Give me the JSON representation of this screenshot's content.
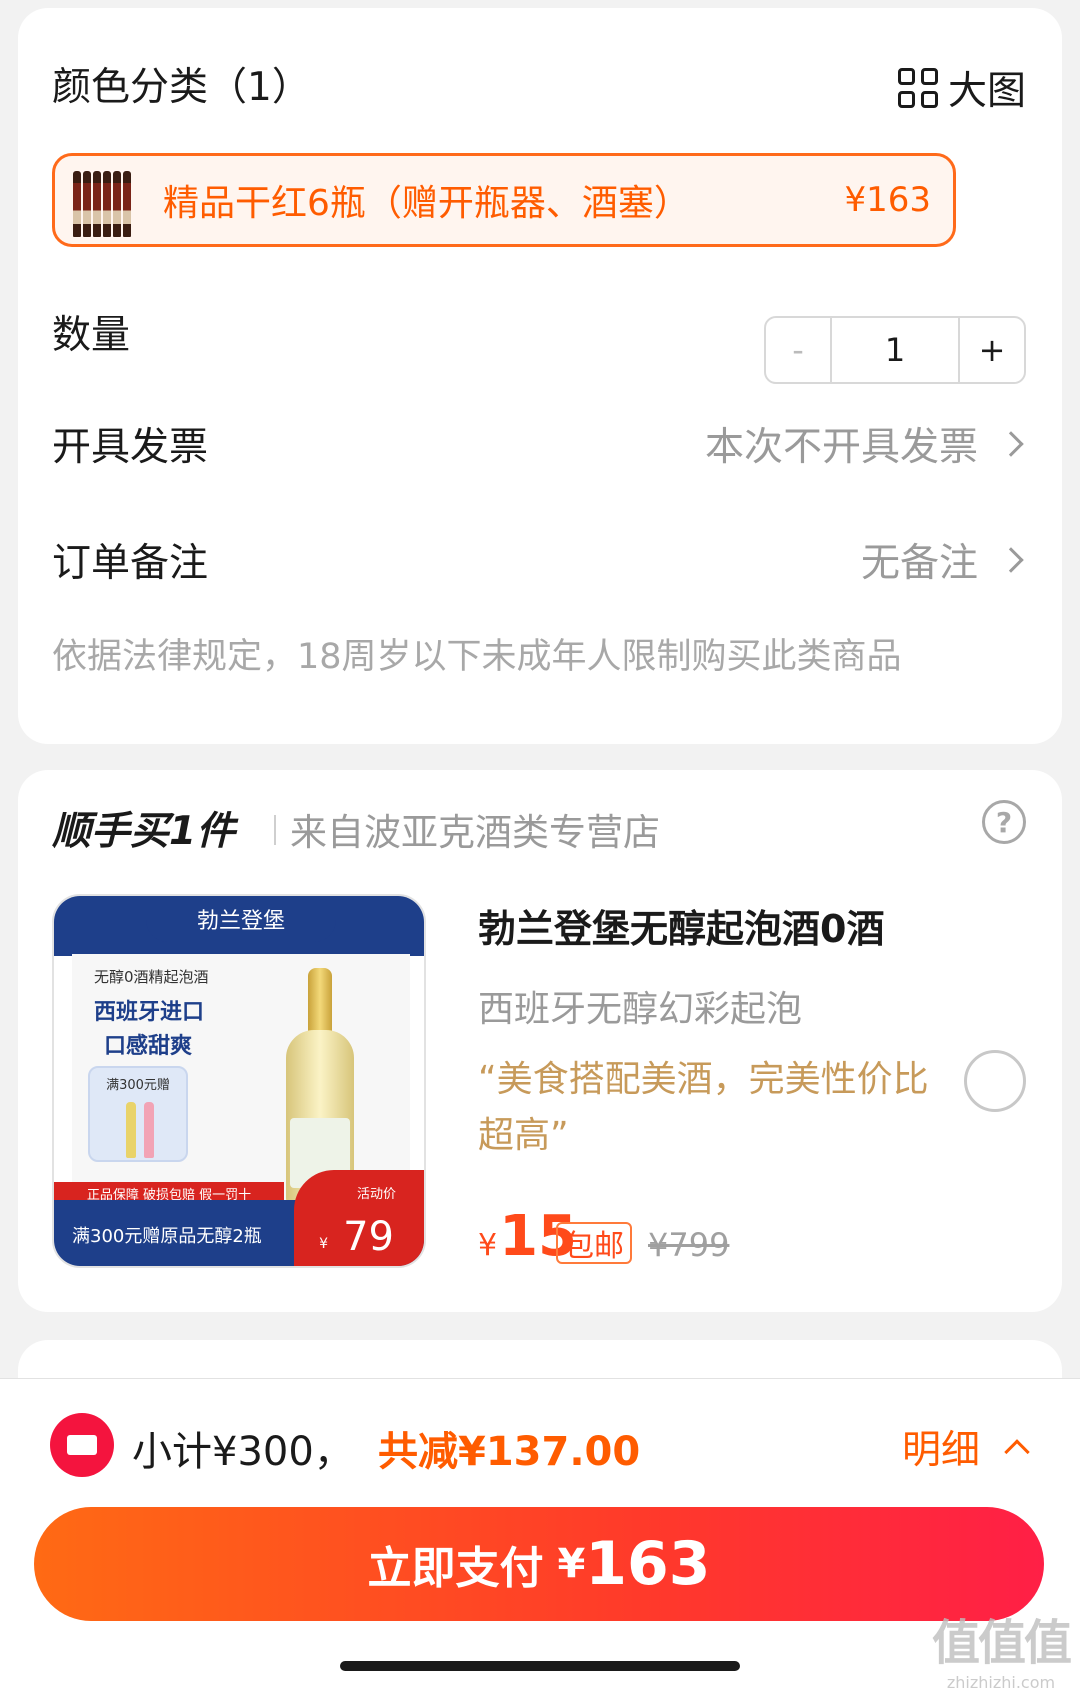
{
  "sku": {
    "header": "颜色分类（1）",
    "big_image_label": "大图",
    "option": {
      "name": "精品干红6瓶（赠开瓶器、酒塞）",
      "price": "¥163"
    }
  },
  "quantity": {
    "label": "数量",
    "minus": "-",
    "value": "1",
    "plus": "+"
  },
  "invoice": {
    "label": "开具发票",
    "value": "本次不开具发票"
  },
  "remark": {
    "label": "订单备注",
    "value": "无备注"
  },
  "legal_note": "依据法律规定，18周岁以下未成年人限制购买此类商品",
  "addon": {
    "title": "顺手买1件",
    "store": "来自波亚克酒类专营店",
    "help": "?",
    "image": {
      "brand": "勃兰登堡",
      "line1": "无醇0酒精起泡酒",
      "line2": "西班牙进口",
      "line3": "口感甜爽",
      "gift": "满300元赠",
      "guarantee": "正品保障 破损包赔 假一罚十",
      "promo": "满300元赠原品无醇2瓶",
      "price_label": "活动价",
      "price_yen": "¥",
      "price": "79"
    },
    "product": {
      "title": "勃兰登堡无醇起泡酒0酒",
      "subtitle": "西班牙无醇幻彩起泡",
      "quote": "“美食搭配美酒，完美性价比超高”",
      "price_symbol": "¥",
      "price": "15",
      "shipping_badge": "包邮",
      "original_price": "¥799"
    }
  },
  "footer": {
    "subtotal": "小计¥300，",
    "discount": "共减¥137.00",
    "detail": "明细",
    "pay_label": "立即支付",
    "pay_symbol": "¥",
    "pay_amount": "163",
    "watermark": "值值值",
    "watermark_site": "zhizhizhi.com"
  },
  "colors": {
    "accent": "#ff5c00",
    "price_red": "#ff4a1a",
    "pay_gradient_end": "#ff1f46"
  }
}
